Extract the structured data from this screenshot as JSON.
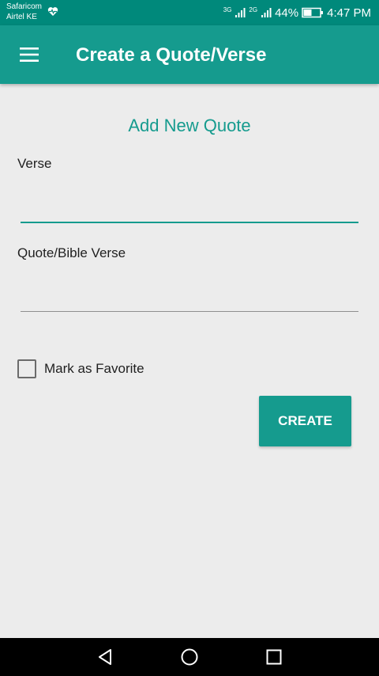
{
  "status_bar": {
    "carrier_1": "Safaricom",
    "carrier_2": "Airtel KE",
    "network_1": "3G",
    "network_2": "2G",
    "battery": "44%",
    "time": "4:47 PM"
  },
  "app_bar": {
    "title": "Create a Quote/Verse",
    "menu_icon": "hamburger-menu-icon"
  },
  "form": {
    "heading": "Add New Quote",
    "verse_label": "Verse",
    "verse_value": "",
    "quote_label": "Quote/Bible Verse",
    "quote_value": "",
    "favorite_label": "Mark as Favorite",
    "favorite_checked": false,
    "create_label": "CREATE"
  },
  "colors": {
    "primary": "#159b8e",
    "status_bar": "#00897b",
    "background": "#ececec"
  },
  "nav_bar": {
    "icons": [
      "back-icon",
      "home-icon",
      "recents-icon"
    ]
  }
}
